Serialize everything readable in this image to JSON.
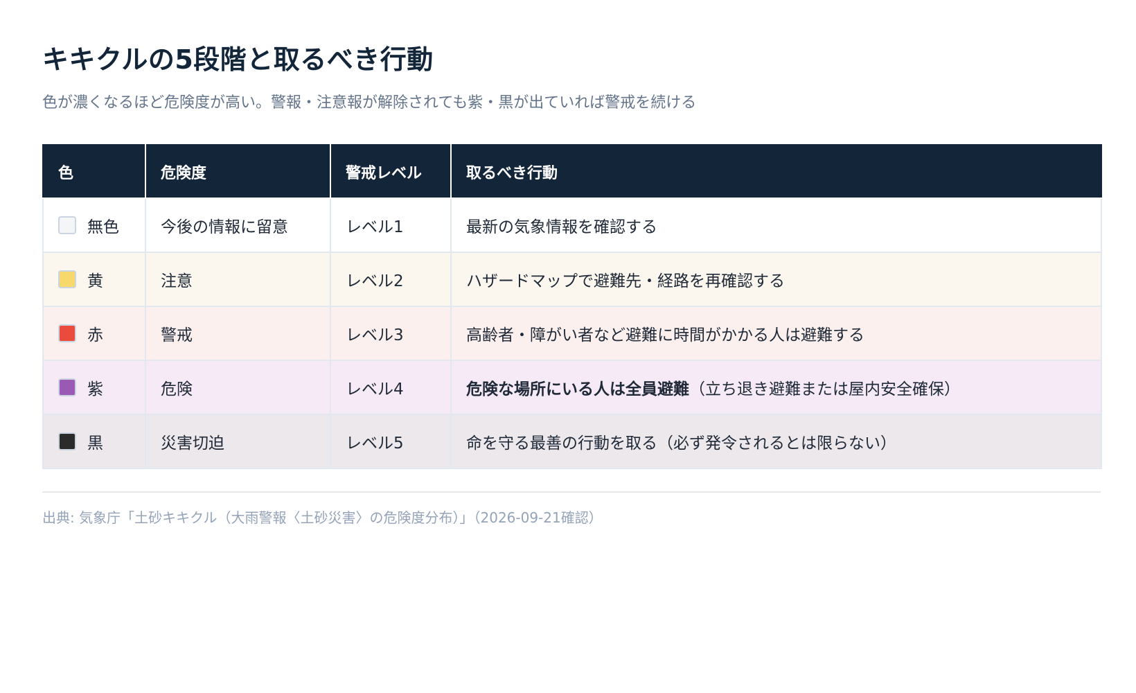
{
  "title": "キキクルの5段階と取るべき行動",
  "subtitle": "色が濃くなるほど危険度が高い。警報・注意報が解除されても紫・黒が出ていれば警戒を続ける",
  "table": {
    "headers": {
      "color": "色",
      "risk": "危険度",
      "alert": "警戒レベル",
      "action": "取るべき行動"
    },
    "rows": [
      {
        "color_label": "無色",
        "swatch": "#f3f5f7",
        "row_bg": "#ffffff",
        "risk": "今後の情報に留意",
        "alert": "レベル1",
        "action_bold": "",
        "action": "最新の気象情報を確認する"
      },
      {
        "color_label": "黄",
        "swatch": "#f7d96b",
        "row_bg": "#fbf7ee",
        "risk": "注意",
        "alert": "レベル2",
        "action_bold": "",
        "action": "ハザードマップで避難先・経路を再確認する"
      },
      {
        "color_label": "赤",
        "swatch": "#e94b3c",
        "row_bg": "#fcf0ee",
        "risk": "警戒",
        "alert": "レベル3",
        "action_bold": "",
        "action": "高齢者・障がい者など避難に時間がかかる人は避難する"
      },
      {
        "color_label": "紫",
        "swatch": "#9b59b6",
        "row_bg": "#f5eaf5",
        "risk": "危険",
        "alert": "レベル4",
        "action_bold": "危険な場所にいる人は全員避難",
        "action": "（立ち退き避難または屋内安全確保）"
      },
      {
        "color_label": "黒",
        "swatch": "#2b2b2b",
        "row_bg": "#ede8eb",
        "risk": "災害切迫",
        "alert": "レベル5",
        "action_bold": "",
        "action": "命を守る最善の行動を取る（必ず発令されるとは限らない）"
      }
    ]
  },
  "source": "出典: 気象庁「土砂キキクル（大雨警報〈土砂災害〉の危険度分布）」（2026-09-21確認）"
}
